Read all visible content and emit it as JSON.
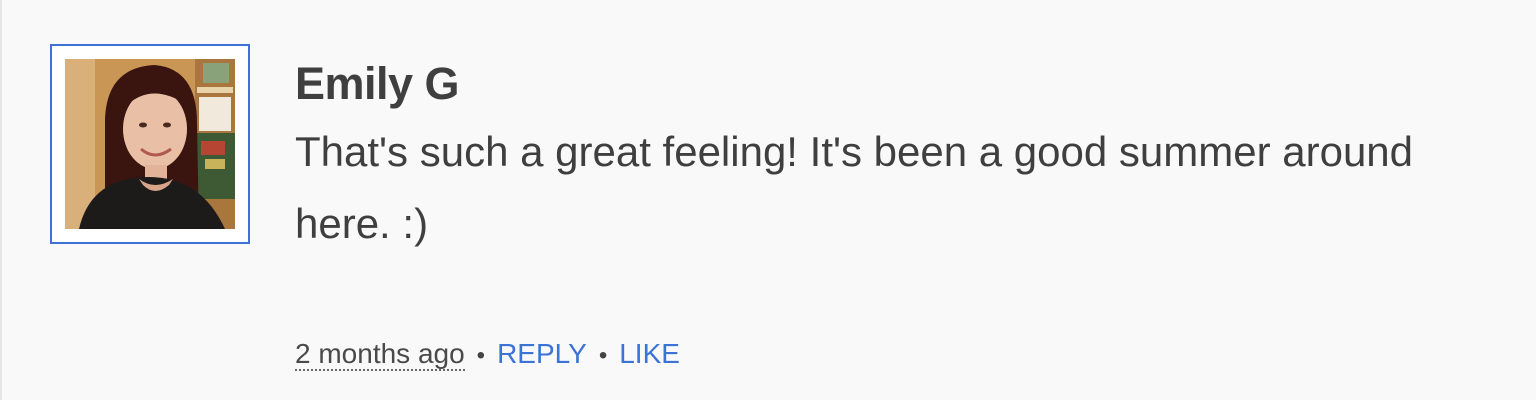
{
  "comment": {
    "author": "Emily G",
    "avatar_icon": "user-avatar-photo",
    "text": "That's such a great feeling! It's been a good summer around here. :)",
    "timestamp": "2 months ago",
    "separator": "•",
    "reply_label": "REPLY",
    "like_label": "LIKE"
  },
  "colors": {
    "background": "#f9f9f9",
    "text": "#3f3f3f",
    "accent": "#3b73d6",
    "avatar_border": "#3f72d8"
  }
}
